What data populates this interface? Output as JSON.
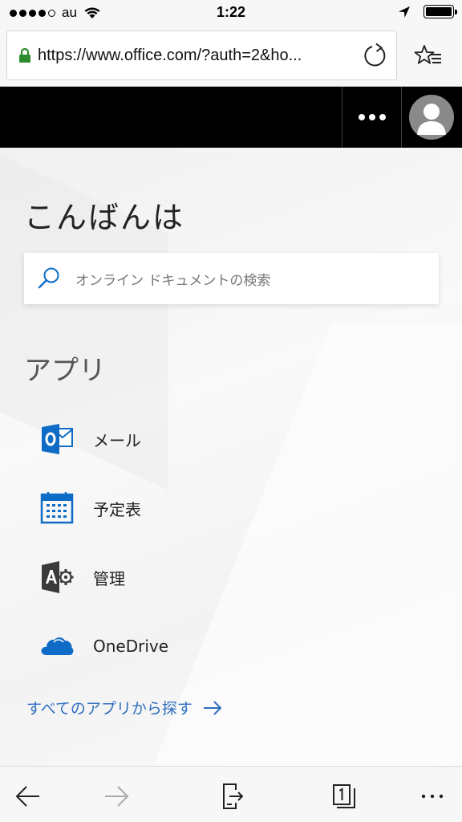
{
  "status_bar": {
    "carrier": "au",
    "time": "1:22"
  },
  "browser": {
    "url": "https://www.office.com/?auth=2&ho..."
  },
  "page": {
    "greeting": "こんばんは",
    "search_placeholder": "オンライン ドキュメントの検索",
    "apps_heading": "アプリ",
    "apps": [
      {
        "label": "メール",
        "icon": "outlook-icon"
      },
      {
        "label": "予定表",
        "icon": "calendar-icon"
      },
      {
        "label": "管理",
        "icon": "admin-icon"
      },
      {
        "label": "OneDrive",
        "icon": "onedrive-icon"
      }
    ],
    "all_apps_link": "すべてのアプリから探す"
  },
  "colors": {
    "link": "#2f6fbf",
    "office_blue": "#0f6cc6",
    "header_bg": "#000000",
    "lock_green": "#2e8b2e"
  }
}
